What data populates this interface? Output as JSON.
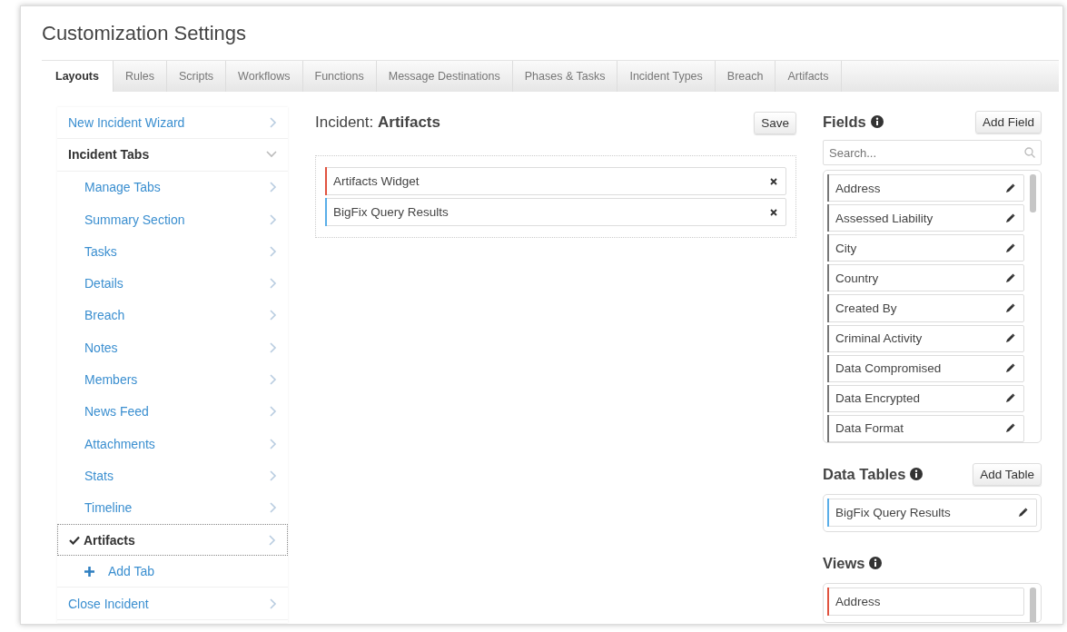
{
  "title": "Customization Settings",
  "tabs": [
    {
      "label": "Layouts",
      "selected": true
    },
    {
      "label": "Rules",
      "selected": false
    },
    {
      "label": "Scripts",
      "selected": false
    },
    {
      "label": "Workflows",
      "selected": false
    },
    {
      "label": "Functions",
      "selected": false
    },
    {
      "label": "Message Destinations",
      "selected": false
    },
    {
      "label": "Phases & Tasks",
      "selected": false
    },
    {
      "label": "Incident Types",
      "selected": false
    },
    {
      "label": "Breach",
      "selected": false
    },
    {
      "label": "Artifacts",
      "selected": false
    }
  ],
  "nav": [
    {
      "kind": "link",
      "label": "New Incident Wizard"
    },
    {
      "kind": "group",
      "label": "Incident Tabs",
      "expanded": true,
      "add_label": "Add Tab",
      "children": [
        {
          "label": "Manage Tabs",
          "selected": false
        },
        {
          "label": "Summary Section",
          "selected": false
        },
        {
          "label": "Tasks",
          "selected": false
        },
        {
          "label": "Details",
          "selected": false
        },
        {
          "label": "Breach",
          "selected": false
        },
        {
          "label": "Notes",
          "selected": false
        },
        {
          "label": "Members",
          "selected": false
        },
        {
          "label": "News Feed",
          "selected": false
        },
        {
          "label": "Attachments",
          "selected": false
        },
        {
          "label": "Stats",
          "selected": false
        },
        {
          "label": "Timeline",
          "selected": false
        },
        {
          "label": "Artifacts",
          "selected": true
        }
      ]
    },
    {
      "kind": "link",
      "label": "Close Incident"
    }
  ],
  "editor": {
    "heading": "Incident: **Artifacts**",
    "save_label": "Save",
    "widgets": [
      {
        "label": "Artifacts Widget",
        "color": "#e0533f"
      },
      {
        "label": "BigFix Query Results",
        "color": "#5aaee8"
      }
    ]
  },
  "fields": {
    "heading": "Fields",
    "add_label": "Add Field",
    "search": {
      "placeholder": "Search..."
    },
    "items": [
      {
        "label": "Address",
        "color": "#777777"
      },
      {
        "label": "Assessed Liability",
        "color": "#777777"
      },
      {
        "label": "City",
        "color": "#777777"
      },
      {
        "label": "Country",
        "color": "#777777"
      },
      {
        "label": "Created By",
        "color": "#777777"
      },
      {
        "label": "Criminal Activity",
        "color": "#777777"
      },
      {
        "label": "Data Compromised",
        "color": "#777777"
      },
      {
        "label": "Data Encrypted",
        "color": "#777777"
      },
      {
        "label": "Data Format",
        "color": "#777777"
      }
    ]
  },
  "data_tables": {
    "heading": "Data Tables",
    "add_label": "Add Table",
    "items": [
      {
        "label": "BigFix Query Results",
        "color": "#5aaee8"
      }
    ]
  },
  "views": {
    "heading": "Views",
    "items": [
      {
        "label": "Address",
        "color": "#e0533f"
      }
    ]
  }
}
